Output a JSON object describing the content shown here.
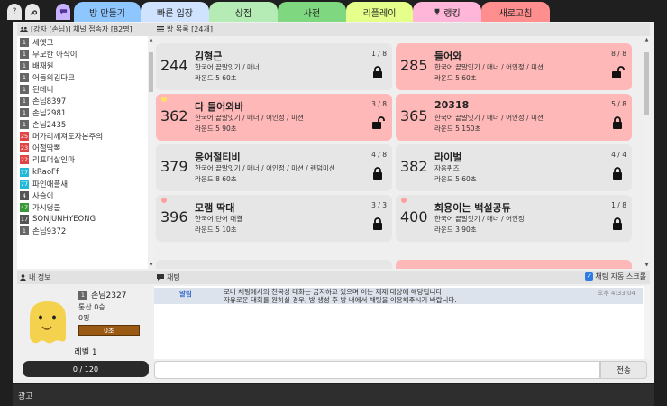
{
  "tabs": [
    {
      "label": "방 만들기",
      "color": "#8ec7ff"
    },
    {
      "label": "빠른 입장",
      "color": "#cfe3ff"
    },
    {
      "label": "상점",
      "color": "#b5ecb5"
    },
    {
      "label": "사전",
      "color": "#7fd87f"
    },
    {
      "label": "리플레이",
      "color": "#e6ff8a"
    },
    {
      "label": "랭킹",
      "color": "#ffb6d9"
    },
    {
      "label": "새로고침",
      "color": "#ff8f8f"
    }
  ],
  "ranking_icon": "trophy-icon",
  "top_icons": [
    "help-icon",
    "settings-icon",
    "chat-icon"
  ],
  "userlist": {
    "header": "[강자 (손님)] 채널 접속자 [82명]",
    "users": [
      {
        "lv": "1",
        "name": "세엣그",
        "color": "#666"
      },
      {
        "lv": "1",
        "name": "무모한 아삭이",
        "color": "#666"
      },
      {
        "lv": "1",
        "name": "배재원",
        "color": "#666"
      },
      {
        "lv": "1",
        "name": "어둡의김다크",
        "color": "#666"
      },
      {
        "lv": "1",
        "name": "된데니",
        "color": "#666"
      },
      {
        "lv": "1",
        "name": "손님8397",
        "color": "#666"
      },
      {
        "lv": "1",
        "name": "손님2981",
        "color": "#666"
      },
      {
        "lv": "1",
        "name": "손님2435",
        "color": "#666"
      },
      {
        "lv": "25",
        "name": "머가리깨져도자본주의",
        "color": "#e04444"
      },
      {
        "lv": "23",
        "name": "어절딱뽁",
        "color": "#e04444"
      },
      {
        "lv": "22",
        "name": "리프더살인마",
        "color": "#e04444"
      },
      {
        "lv": "77",
        "name": "kRaoFf",
        "color": "#22b8d8"
      },
      {
        "lv": "77",
        "name": "파인애플새",
        "color": "#22b8d8"
      },
      {
        "lv": "4",
        "name": "사슬이",
        "color": "#555"
      },
      {
        "lv": "47",
        "name": "가시덩쿨",
        "color": "#3a9a3a"
      },
      {
        "lv": "17",
        "name": "SONJUNHYEONG",
        "color": "#555"
      },
      {
        "lv": "1",
        "name": "손님9372",
        "color": "#666"
      }
    ]
  },
  "rooms": {
    "header": "방 목록 [24개]",
    "list": [
      {
        "num": "244",
        "title": "김형근",
        "opts": "한국어 끝말잇기 / 매너",
        "info": "라운드 5   60초",
        "count": "1 / 8",
        "style": "gray",
        "lock": "locked",
        "dot": ""
      },
      {
        "num": "285",
        "title": "들어와",
        "opts": "한국어 끝말잇기 / 매너 / 어인정 / 미션",
        "info": "라운드 5   60초",
        "count": "8 / 8",
        "style": "pink",
        "lock": "unlocked",
        "dot": ""
      },
      {
        "num": "362",
        "title": "다 들어와바",
        "opts": "한국어 끝말잇기 / 매너 / 어인정 / 미션",
        "info": "라운드 5   90초",
        "count": "3 / 8",
        "style": "pink",
        "lock": "unlocked",
        "dot": "#ffe066"
      },
      {
        "num": "365",
        "title": "20318",
        "opts": "한국어 끝말잇기 / 매너 / 어인정 / 미션",
        "info": "라운드 5   150초",
        "count": "5 / 8",
        "style": "pink",
        "lock": "locked",
        "dot": ""
      },
      {
        "num": "379",
        "title": "응어절티비",
        "opts": "한국어 끝말잇기 / 매너 / 어인정 / 미션 / 랜덤미션",
        "info": "라운드 8   60초",
        "count": "4 / 8",
        "style": "gray",
        "lock": "locked",
        "dot": ""
      },
      {
        "num": "382",
        "title": "라이벌",
        "opts": "자음퀴즈",
        "info": "라운드 5   60초",
        "count": "4 / 4",
        "style": "gray",
        "lock": "locked",
        "dot": ""
      },
      {
        "num": "396",
        "title": "모램 딱대",
        "opts": "한국어 단어 대결",
        "info": "라운드 5   10초",
        "count": "3 / 3",
        "style": "gray",
        "lock": "locked",
        "dot": "#ff9f9f"
      },
      {
        "num": "400",
        "title": "회용이는 백설공듀",
        "opts": "한국어 끝말잇기 / 매너 / 어인정",
        "info": "라운드 3   90초",
        "count": "1 / 8",
        "style": "gray",
        "lock": "locked",
        "dot": "#ff9f9f"
      }
    ]
  },
  "myinfo": {
    "header": "내 정보",
    "lv": "1",
    "name": "손님2327",
    "record": "통산 0승",
    "money": "0핑",
    "bar_label": "0초",
    "level": "레벨 1",
    "exp": "0 / 120"
  },
  "chat": {
    "header": "채팅",
    "autoscroll": "채팅 자동 스크롤",
    "autoscroll_checked": true,
    "messages": [
      {
        "who": "알림",
        "text": "로비 채팅에서의 친목성 대화는 금지하고 있으며 이는 제재 대상에 해당됩니다.\n자유로운 대화를 원하실 경우, 방 생성 후 방 내에서 채팅을 이용해주시기 바랍니다.",
        "time": "오후 4:33:04"
      }
    ],
    "send_label": "전송"
  },
  "ad": "광고",
  "colors": {
    "accent_pink": "#ffb8b8",
    "room_gray": "#e6e6e6",
    "bar_brown": "#9a5a14"
  }
}
